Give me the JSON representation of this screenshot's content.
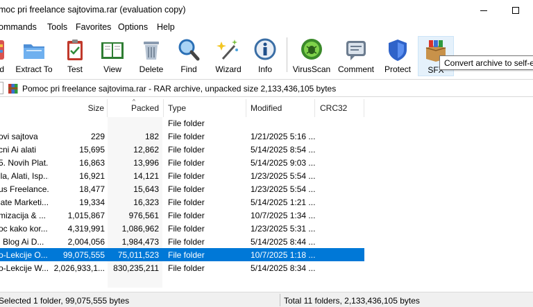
{
  "window": {
    "title": "moc pri freelance sajtovima.rar (evaluation copy)"
  },
  "menu": [
    "ommands",
    "Tools",
    "Favorites",
    "Options",
    "Help"
  ],
  "toolbar": [
    {
      "label": "d",
      "icon": "add-icon"
    },
    {
      "label": "Extract To",
      "icon": "extract-folder-icon"
    },
    {
      "label": "Test",
      "icon": "test-clipboard-icon"
    },
    {
      "label": "View",
      "icon": "view-book-icon"
    },
    {
      "label": "Delete",
      "icon": "trash-icon"
    },
    {
      "label": "Find",
      "icon": "magnifier-icon"
    },
    {
      "label": "Wizard",
      "icon": "wand-icon"
    },
    {
      "label": "Info",
      "icon": "info-icon"
    },
    {
      "label": "VirusScan",
      "icon": "virus-scan-icon"
    },
    {
      "label": "Comment",
      "icon": "comment-icon"
    },
    {
      "label": "Protect",
      "icon": "shield-icon"
    },
    {
      "label": "SFX",
      "icon": "sfx-box-icon"
    }
  ],
  "tooltip": "Convert archive to self-e",
  "address": {
    "path": "Pomoc pri freelance sajtovima.rar - RAR archive, unpacked size 2,133,436,105 bytes"
  },
  "columns": {
    "size": "Size",
    "packed": "Packed",
    "type": "Type",
    "modified": "Modified",
    "crc": "CRC32"
  },
  "files": [
    {
      "name": "",
      "size": "",
      "packed": "",
      "type": "File folder",
      "modified": ""
    },
    {
      "name": "ovi sajtova",
      "size": "229",
      "packed": "182",
      "type": "File folder",
      "modified": "1/21/2025 5:16 ..."
    },
    {
      "name": "cni Ai alati",
      "size": "15,695",
      "packed": "12,862",
      "type": "File folder",
      "modified": "5/14/2025 8:54 ..."
    },
    {
      "name": "5. Novih Plat...",
      "size": "16,863",
      "packed": "13,996",
      "type": "File folder",
      "modified": "5/14/2025 9:03 ..."
    },
    {
      "name": "ila, Alati, Isp...",
      "size": "16,921",
      "packed": "14,121",
      "type": "File folder",
      "modified": "1/23/2025 5:54 ..."
    },
    {
      "name": "us Freelance...",
      "size": "18,477",
      "packed": "15,643",
      "type": "File folder",
      "modified": "1/23/2025 5:54 ..."
    },
    {
      "name": "iate Marketi...",
      "size": "19,334",
      "packed": "16,323",
      "type": "File folder",
      "modified": "5/14/2025 1:21 ..."
    },
    {
      "name": "mizacija & ...",
      "size": "1,015,867",
      "packed": "976,561",
      "type": "File folder",
      "modified": "10/7/2025 1:34 ..."
    },
    {
      "name": "oc kako kor...",
      "size": "4,319,991",
      "packed": "1,086,962",
      "type": "File folder",
      "modified": "1/23/2025 5:31 ..."
    },
    {
      "name": "i Blog Ai D...",
      "size": "2,004,056",
      "packed": "1,984,473",
      "type": "File folder",
      "modified": "5/14/2025 8:44 ..."
    },
    {
      "name": "o-Lekcije O...",
      "size": "99,075,555",
      "packed": "75,011,523",
      "type": "File folder",
      "modified": "10/7/2025 1:18 ...",
      "selected": true
    },
    {
      "name": "o-Lekcije W...",
      "size": "2,026,933,1...",
      "packed": "830,235,211",
      "type": "File folder",
      "modified": "5/14/2025 8:34 ..."
    }
  ],
  "status": {
    "left": "Selected 1 folder, 99,075,555 bytes",
    "right": "Total 11 folders, 2,133,436,105 bytes"
  },
  "colors": {
    "selection": "#0078d7",
    "accent": "#0078d7"
  }
}
